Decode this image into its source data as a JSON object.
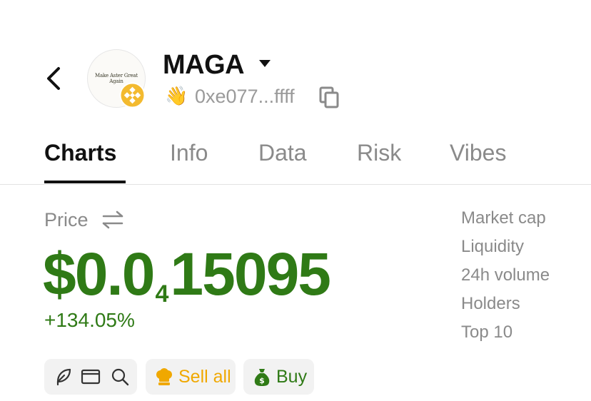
{
  "header": {
    "token_name": "MAGA",
    "logo_text": "Make Aster Great Again",
    "address": "0xe077...ffff",
    "hand_emoji": "👋"
  },
  "tabs": [
    {
      "label": "Charts",
      "active": true
    },
    {
      "label": "Info",
      "active": false
    },
    {
      "label": "Data",
      "active": false
    },
    {
      "label": "Risk",
      "active": false
    },
    {
      "label": "Vibes",
      "active": false
    }
  ],
  "price": {
    "label": "Price",
    "prefix": "$0.0",
    "zero_count": "4",
    "digits": "15095",
    "change": "+134.05%"
  },
  "stats": [
    "Market cap",
    "Liquidity",
    "24h volume",
    "Holders",
    "Top 10"
  ],
  "actions": {
    "sell_label": "Sell all",
    "buy_label": "Buy"
  },
  "colors": {
    "positive": "#2f7a16",
    "sell": "#f0a800",
    "muted": "#8a8a8a",
    "chain_badge": "#f3ba2f"
  },
  "icons": [
    "back-arrow-icon",
    "bnb-chain-icon",
    "caret-down-icon",
    "waving-hand-icon",
    "copy-icon",
    "swap-icon",
    "feather-icon",
    "browser-window-icon",
    "search-icon",
    "chef-hat-icon",
    "money-bag-icon"
  ]
}
